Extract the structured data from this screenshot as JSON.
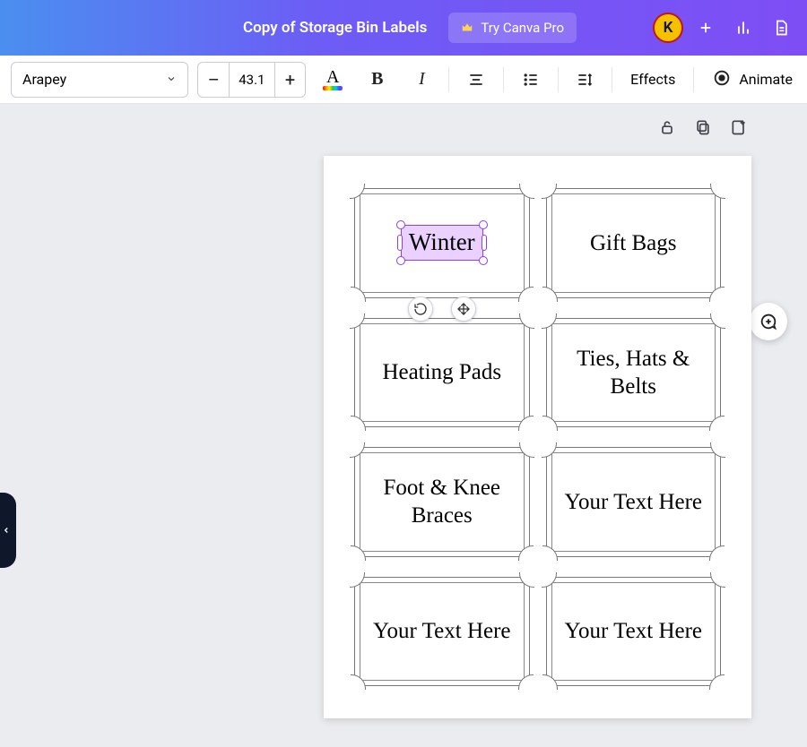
{
  "header": {
    "doc_title": "Copy of Storage Bin Labels",
    "try_pro_label": "Try Canva Pro",
    "avatar_initial": "K"
  },
  "toolbar": {
    "font_name": "Arapey",
    "font_size": "43.1",
    "effects_label": "Effects",
    "animate_label": "Animate"
  },
  "labels": [
    {
      "text": "Winter",
      "selected": true
    },
    {
      "text": "Gift Bags"
    },
    {
      "text": "Heating Pads"
    },
    {
      "text": "Ties, Hats & Belts"
    },
    {
      "text": "Foot & Knee Braces"
    },
    {
      "text": "Your Text Here"
    },
    {
      "text": "Your Text Here"
    },
    {
      "text": "Your Text Here"
    }
  ]
}
